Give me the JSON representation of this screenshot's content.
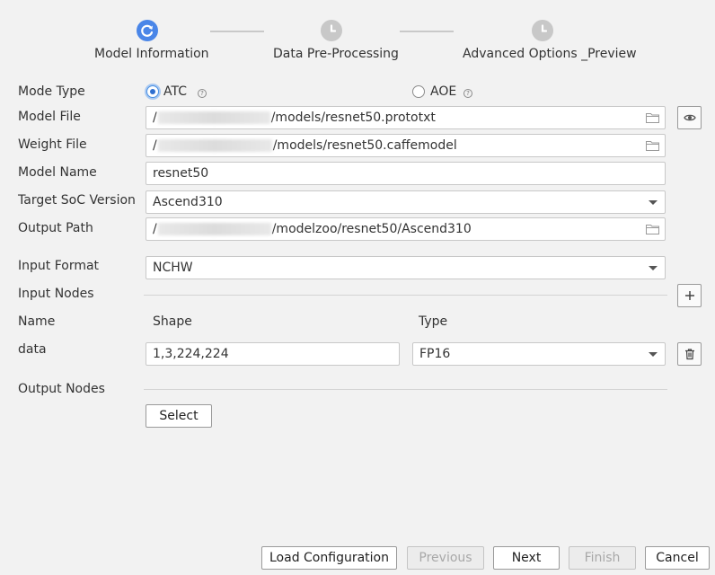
{
  "stepper": {
    "steps": [
      {
        "label": "Model Information",
        "state": "active",
        "icon": "refresh-icon"
      },
      {
        "label": "Data Pre-Processing",
        "state": "pending",
        "icon": "clock-icon"
      },
      {
        "label": "Advanced Options _Preview",
        "state": "pending",
        "icon": "clock-icon"
      }
    ]
  },
  "form": {
    "mode_type": {
      "label": "Mode Type",
      "options": [
        {
          "label": "ATC",
          "checked": true
        },
        {
          "label": "AOE",
          "checked": false
        }
      ]
    },
    "model_file": {
      "label": "Model File",
      "prefix": "/",
      "suffix": "/models/resnet50.prototxt"
    },
    "weight_file": {
      "label": "Weight File",
      "prefix": "/",
      "suffix": "/models/resnet50.caffemodel"
    },
    "model_name": {
      "label": "Model Name",
      "value": "resnet50"
    },
    "target_soc": {
      "label": "Target SoC Version",
      "value": "Ascend310"
    },
    "output_path": {
      "label": "Output Path",
      "prefix": "/",
      "suffix": "/modelzoo/resnet50/Ascend310"
    },
    "input_format": {
      "label": "Input Format",
      "value": "NCHW"
    },
    "input_nodes": {
      "label": "Input Nodes",
      "columns": {
        "name": "Name",
        "shape": "Shape",
        "type": "Type"
      },
      "rows": [
        {
          "name": "data",
          "shape": "1,3,224,224",
          "type": "FP16"
        }
      ]
    },
    "output_nodes": {
      "label": "Output Nodes",
      "select_label": "Select"
    }
  },
  "footer": {
    "load_config": "Load Configuration",
    "previous": "Previous",
    "next": "Next",
    "finish": "Finish",
    "cancel": "Cancel"
  },
  "colors": {
    "accent": "#4a90e2",
    "pending": "#c8c8c8"
  }
}
